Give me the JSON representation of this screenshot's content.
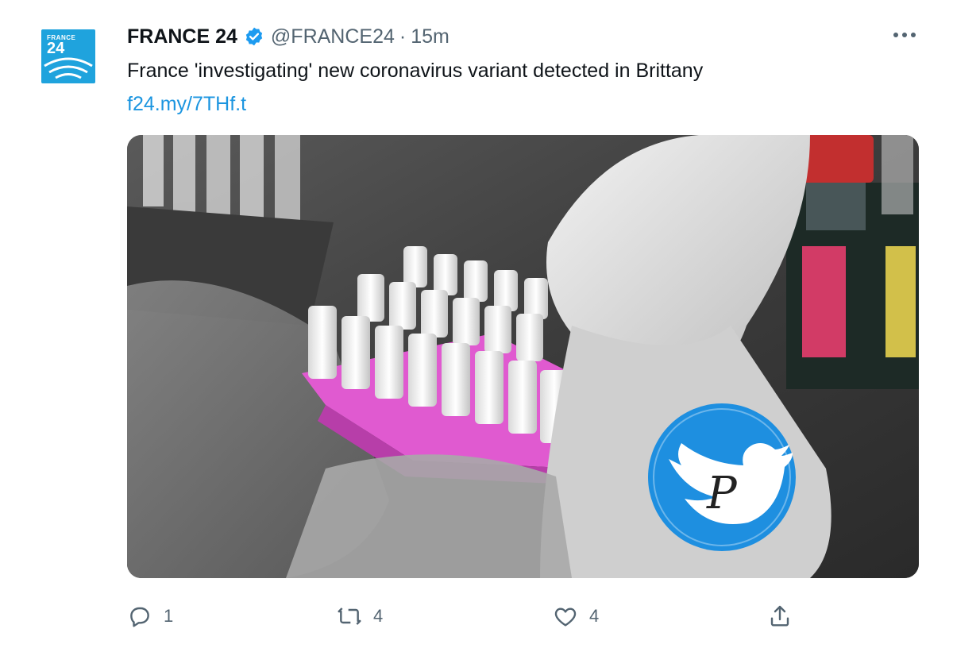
{
  "account": {
    "avatar_brand_top": "FRANCE",
    "avatar_brand_num": "24",
    "display_name": "FRANCE 24",
    "handle": "@FRANCE24",
    "separator": "·",
    "timestamp": "15m"
  },
  "tweet": {
    "text": "France 'investigating' new coronavirus variant detected in Brittany",
    "link": "f24.my/7THf.t"
  },
  "actions": {
    "reply_count": "1",
    "retweet_count": "4",
    "like_count": "4"
  },
  "colors": {
    "link": "#1b95e0",
    "verified": "#1d9bf0",
    "watermark": "#1e8fe0",
    "rack": "#e05ad0"
  },
  "icons": [
    "france24-logo",
    "verified-badge-icon",
    "more-icon",
    "reply-icon",
    "retweet-icon",
    "like-icon",
    "share-icon",
    "watermark-bird-logo"
  ]
}
